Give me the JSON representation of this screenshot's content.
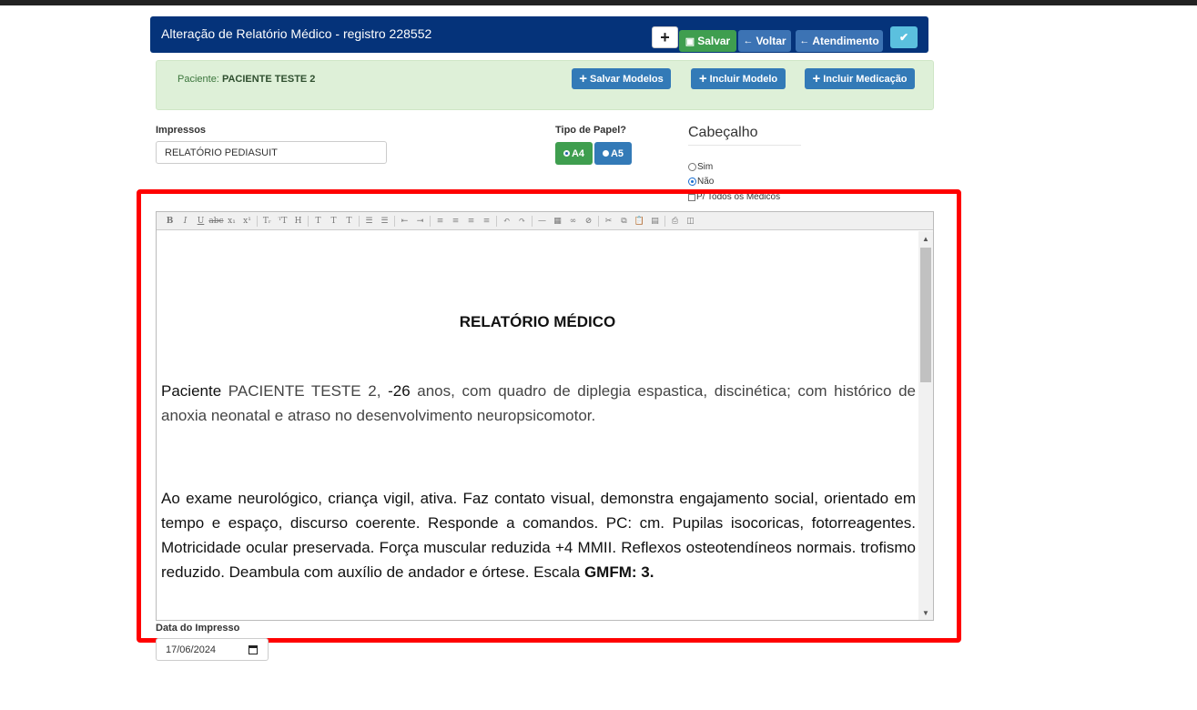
{
  "header": {
    "title": "Alteração de Relatório Médico - registro 228552",
    "add_label": "+",
    "save_label": "Salvar",
    "back_label": "Voltar",
    "atendimento_label": "Atendimento",
    "confirm_label": "✔"
  },
  "patient": {
    "label": "Paciente:",
    "name": "PACIENTE TESTE 2",
    "buttons": {
      "save_models": "Salvar Modelos",
      "include_model": "Incluir Modelo",
      "include_medication": "Incluir Medicação"
    }
  },
  "impressos": {
    "label": "Impressos",
    "selected": "RELATÓRIO PEDIASUIT"
  },
  "paper": {
    "label": "Tipo de Papel?",
    "options": [
      "A4",
      "A5"
    ],
    "selected": "A4"
  },
  "cabecalho": {
    "title": "Cabeçalho",
    "options": [
      "Sim",
      "Não"
    ],
    "selected": "Não",
    "all_doctors_label": "P/ Todos os Médicos"
  },
  "document": {
    "title": "RELATÓRIO MÉDICO",
    "p1_label": "Paciente",
    "p1_name": " PACIENTE TESTE 2,",
    "p1_age": "  -26",
    "p1_rest": " anos, com quadro de diplegia espastica, discinética; com histórico de anoxia neonatal e atraso no desenvolvimento neuropsicomotor.",
    "p2_text": "Ao exame neurológico, criança vigil, ativa. Faz contato visual, demonstra engajamento social, orientado em tempo e espaço, discurso coerente. Responde a comandos. PC: cm. Pupilas isocoricas, fotorreagentes. Motricidade ocular preservada. Força muscular reduzida +4 MMII. Reflexos osteotendíneos normais. trofismo reduzido. Deambula com auxílio de andador e órtese. Escala ",
    "p2_bold": "GMFM: 3."
  },
  "date": {
    "label": "Data do Impresso",
    "value": "17/06/2024"
  },
  "colors": {
    "header_bg": "#05337a",
    "success": "#3f9e4f",
    "primary": "#337ab7",
    "info": "#5bc0de",
    "highlight_frame": "#ff0000",
    "panel_bg": "#def0d8"
  }
}
